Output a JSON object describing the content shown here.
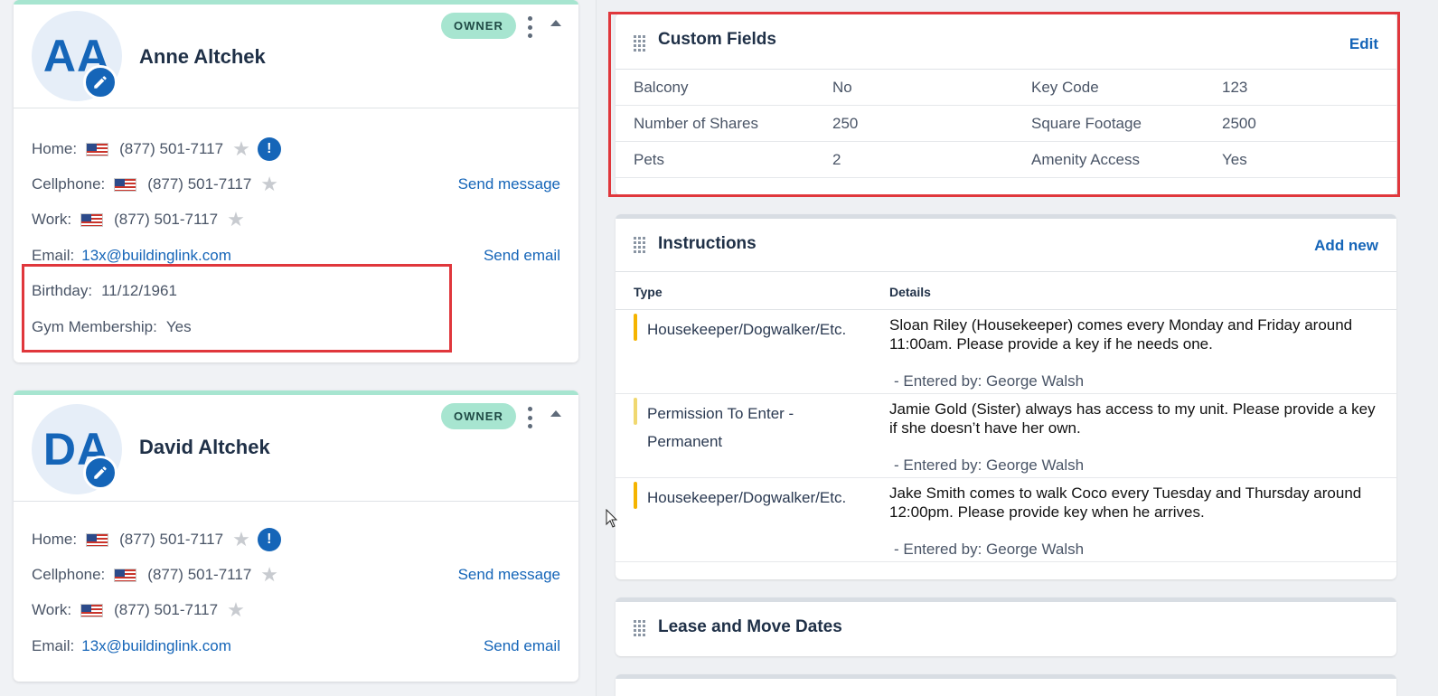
{
  "contacts": [
    {
      "initials": "AA",
      "name": "Anne Altchek",
      "badge": "OWNER",
      "home_label": "Home:",
      "home_phone": "(877) 501-7117",
      "cell_label": "Cellphone:",
      "cell_phone": "(877) 501-7117",
      "send_message": "Send message",
      "work_label": "Work:",
      "work_phone": "(877) 501-7117",
      "email_label": "Email:",
      "email": "13x@buildinglink.com",
      "send_email": "Send email",
      "birthday_label": "Birthday:",
      "birthday": "11/12/1961",
      "gym_label": "Gym Membership:",
      "gym": "Yes"
    },
    {
      "initials": "DA",
      "name": "David Altchek",
      "badge": "OWNER",
      "home_label": "Home:",
      "home_phone": "(877) 501-7117",
      "cell_label": "Cellphone:",
      "cell_phone": "(877) 501-7117",
      "send_message": "Send message",
      "work_label": "Work:",
      "work_phone": "(877) 501-7117",
      "email_label": "Email:",
      "email": "13x@buildinglink.com",
      "send_email": "Send email"
    }
  ],
  "custom_fields": {
    "title": "Custom Fields",
    "action": "Edit",
    "rows": [
      {
        "k1": "Balcony",
        "v1": "No",
        "k2": "Key Code",
        "v2": "123"
      },
      {
        "k1": "Number of Shares",
        "v1": "250",
        "k2": "Square Footage",
        "v2": "2500"
      },
      {
        "k1": "Pets",
        "v1": "2",
        "k2": "Amenity Access",
        "v2": "Yes"
      }
    ]
  },
  "instructions": {
    "title": "Instructions",
    "action": "Add new",
    "col_type": "Type",
    "col_details": "Details",
    "rows": [
      {
        "type": "Housekeeper/Dogwalker/Etc.",
        "details": "Sloan Riley (Housekeeper) comes every Monday and Friday around 11:00am. Please provide a key if he needs one.",
        "entered_by": "- Entered by: George Walsh",
        "color": "#f5b400"
      },
      {
        "type": "Permission To Enter - Permanent",
        "details": "Jamie Gold (Sister) always has access to my unit. Please provide a key if she doesn’t have her own.",
        "entered_by": "- Entered by: George Walsh",
        "color": "#f0d870"
      },
      {
        "type": "Housekeeper/Dogwalker/Etc.",
        "details": "Jake Smith comes to walk Coco every Tuesday and Thursday around 12:00pm. Please provide key when he arrives.",
        "entered_by": "- Entered by: George Walsh",
        "color": "#f5b400"
      }
    ]
  },
  "lease": {
    "title": "Lease and Move Dates"
  },
  "colors": {
    "accent": "#1565b8",
    "owner_badge": "#a7e5d0",
    "highlight": "#e0373c"
  }
}
